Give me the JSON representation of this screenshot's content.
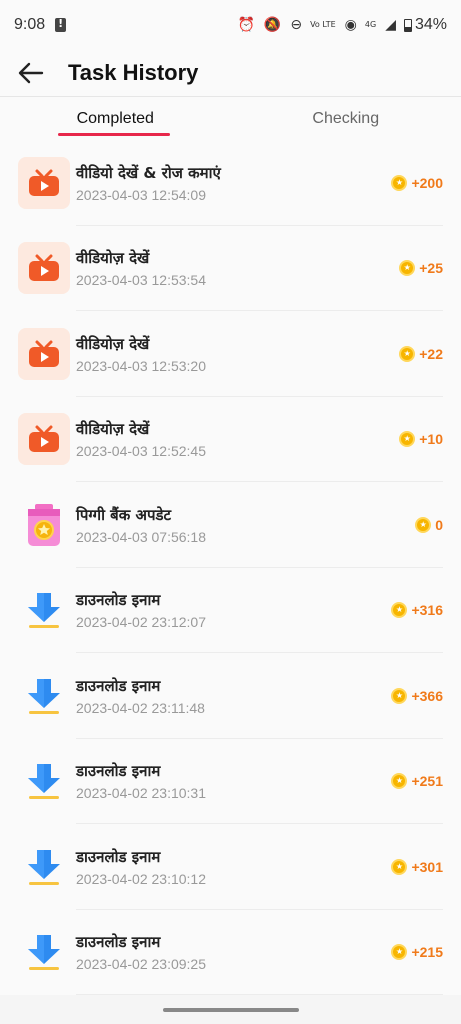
{
  "status": {
    "time": "9:08",
    "network_label": "4G",
    "volte_label": "Vo LTE",
    "battery": "34%"
  },
  "header": {
    "title": "Task History"
  },
  "tabs": [
    {
      "label": "Completed",
      "active": true
    },
    {
      "label": "Checking",
      "active": false
    }
  ],
  "colors": {
    "accent": "#e7274a",
    "reward": "#f07a1a",
    "coin": "#f7b500"
  },
  "tasks": [
    {
      "title": "वीडियो देखें & रोज कमाएं",
      "time": "2023-04-03 12:54:09",
      "reward": "+200",
      "icon": "video-play-icon"
    },
    {
      "title": "वीडियोज़ देखें",
      "time": "2023-04-03 12:53:54",
      "reward": "+25",
      "icon": "video-play-icon"
    },
    {
      "title": "वीडियोज़ देखें",
      "time": "2023-04-03 12:53:20",
      "reward": "+22",
      "icon": "video-play-icon"
    },
    {
      "title": "वीडियोज़ देखें",
      "time": "2023-04-03 12:52:45",
      "reward": "+10",
      "icon": "video-play-icon"
    },
    {
      "title": "पिग्गी बैंक अपडेट",
      "time": "2023-04-03 07:56:18",
      "reward": "0",
      "icon": "piggy-bank-jar-icon"
    },
    {
      "title": "डाउनलोड इनाम",
      "time": "2023-04-02 23:12:07",
      "reward": "+316",
      "icon": "download-arrow-icon"
    },
    {
      "title": "डाउनलोड इनाम",
      "time": "2023-04-02 23:11:48",
      "reward": "+366",
      "icon": "download-arrow-icon"
    },
    {
      "title": "डाउनलोड इनाम",
      "time": "2023-04-02 23:10:31",
      "reward": "+251",
      "icon": "download-arrow-icon"
    },
    {
      "title": "डाउनलोड इनाम",
      "time": "2023-04-02 23:10:12",
      "reward": "+301",
      "icon": "download-arrow-icon"
    },
    {
      "title": "डाउनलोड इनाम",
      "time": "2023-04-02 23:09:25",
      "reward": "+215",
      "icon": "download-arrow-icon"
    }
  ]
}
